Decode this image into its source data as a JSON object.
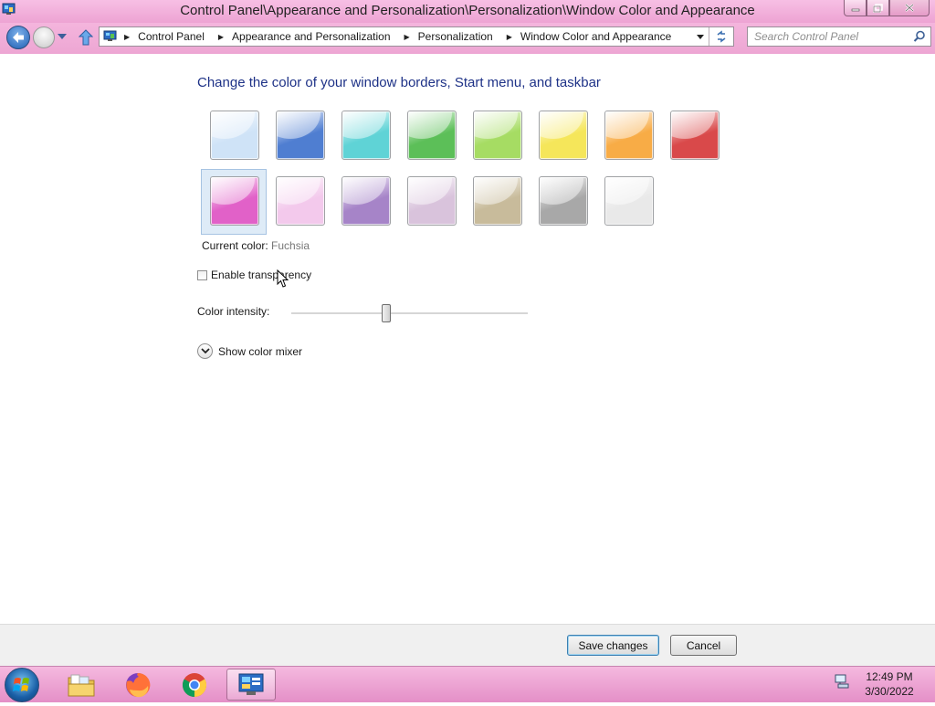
{
  "window": {
    "title": "Control Panel\\Appearance and Personalization\\Personalization\\Window Color and Appearance"
  },
  "navigation": {
    "breadcrumbs": [
      "Control Panel",
      "Appearance and Personalization",
      "Personalization",
      "Window Color and Appearance"
    ],
    "search_placeholder": "Search Control Panel"
  },
  "content": {
    "heading": "Change the color of your window borders, Start menu, and taskbar",
    "swatches": [
      {
        "color": "#cfe3f7"
      },
      {
        "color": "#4f7ed1"
      },
      {
        "color": "#5fd3d6"
      },
      {
        "color": "#5cbf58"
      },
      {
        "color": "#a6dc63"
      },
      {
        "color": "#f5e65a"
      },
      {
        "color": "#f8ac46"
      },
      {
        "color": "#d9494a"
      },
      {
        "color": "#e161c8"
      },
      {
        "color": "#f3c9ec"
      },
      {
        "color": "#a684c8"
      },
      {
        "color": "#d9c3dc"
      },
      {
        "color": "#c8bb9b"
      },
      {
        "color": "#a8a8a8"
      },
      {
        "color": "#e9e9e9"
      }
    ],
    "selected_swatch_index": 8,
    "current_color_label": "Current color:",
    "current_color_value": "Fuchsia",
    "transparency_label": "Enable transparency",
    "transparency_checked": false,
    "intensity_label": "Color intensity:",
    "intensity_value": 0.4,
    "color_mixer_label": "Show color mixer"
  },
  "footer": {
    "save_label": "Save changes",
    "cancel_label": "Cancel"
  },
  "taskbar": {
    "items": [
      "start-button",
      "explorer-icon",
      "firefox-icon",
      "chrome-icon",
      "control-panel-icon"
    ],
    "time": "12:49 PM",
    "date": "3/30/2022"
  },
  "colors": {
    "title_bar": "#f0acd8",
    "accent": "#e161c8",
    "heading": "#1e3287"
  }
}
